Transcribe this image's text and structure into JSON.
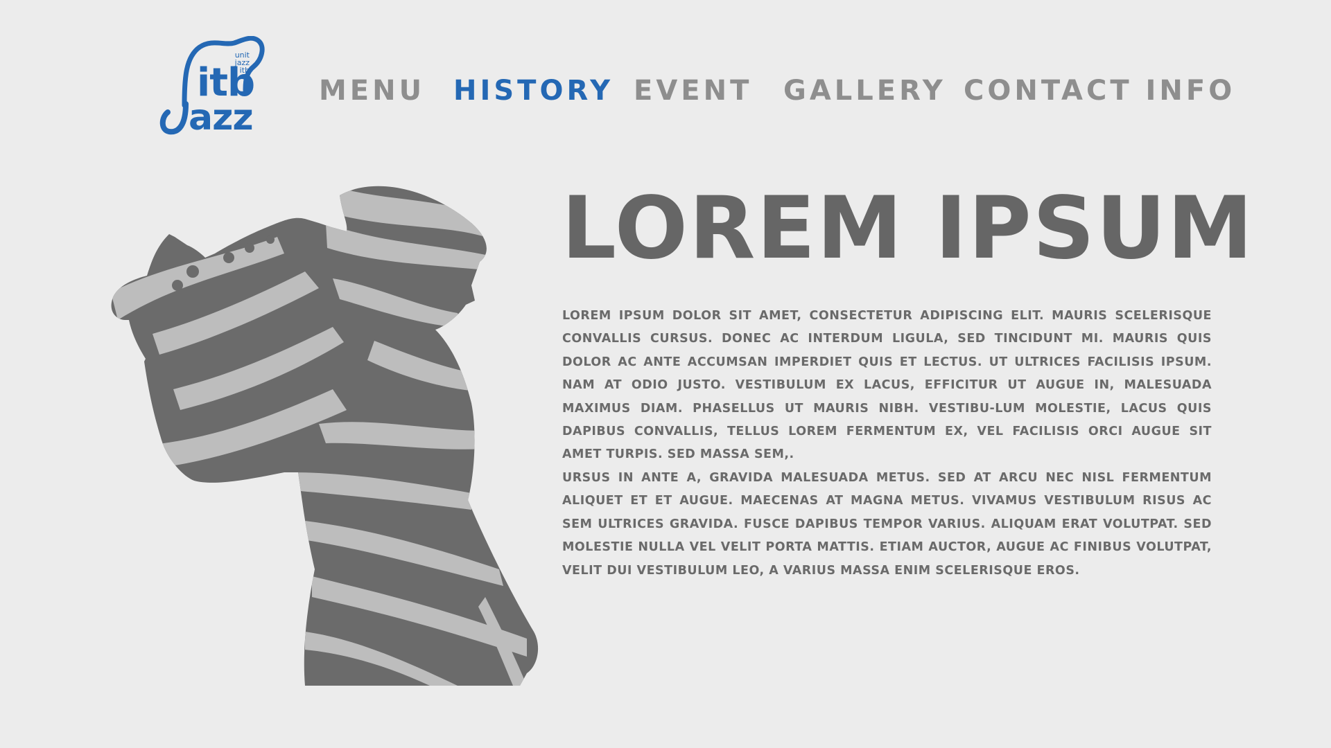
{
  "logo": {
    "word_top": "itb",
    "word_bottom": "azz",
    "small_lines": [
      "unit",
      "jazz",
      "itb"
    ],
    "brand_color": "#2468b4"
  },
  "nav": {
    "items": [
      {
        "label": "MENU",
        "active": false
      },
      {
        "label": "HISTORY",
        "active": true
      },
      {
        "label": "EVENT",
        "active": false
      },
      {
        "label": "GALLERY",
        "active": false
      },
      {
        "label": "CONTACT INFO",
        "active": false
      }
    ],
    "active_color": "#2468b4",
    "inactive_color": "#8e8e8e"
  },
  "illustration": {
    "icon": "saxophone-player-silhouette-icon",
    "stripe_dark": "#6b6b6b",
    "stripe_light": "#bdbdbd"
  },
  "content": {
    "headline": "LOREM IPSUM",
    "paragraph_1": "Lorem ipsum dolor sit amet, consectetur adipiscing elit. Mauris scelerisque convallis cursus. Donec ac interdum ligula, sed tincidunt mi. Mauris quis dolor ac ante accumsan imperdiet quis et lectus. Ut ultrices facilisis ipsum. Nam at odio justo. Vestibulum ex lacus, efficitur ut augue in, malesuada maximus diam. Phasellus ut mauris nibh. Vestibu-lum molestie, lacus quis dapibus convallis, tellus lorem fermentum ex, vel facilisis orci augue sit amet turpis. Sed massa sem,.",
    "paragraph_2": "Ursus in ante a, gravida malesuada metus. Sed at arcu nec nisl fermentum aliquet et et augue. Maecenas at magna metus. Vivamus vestibulum risus ac sem ultrices gravida. Fusce dapibus tempor varius. Aliquam erat volutpat. Sed molestie nulla vel velit porta mattis. Etiam auctor, augue ac finibus volutpat, velit dui vestibulum leo, a varius massa enim scelerisque eros.",
    "text_color": "#6a6a6a"
  },
  "page": {
    "background": "#ececec"
  }
}
